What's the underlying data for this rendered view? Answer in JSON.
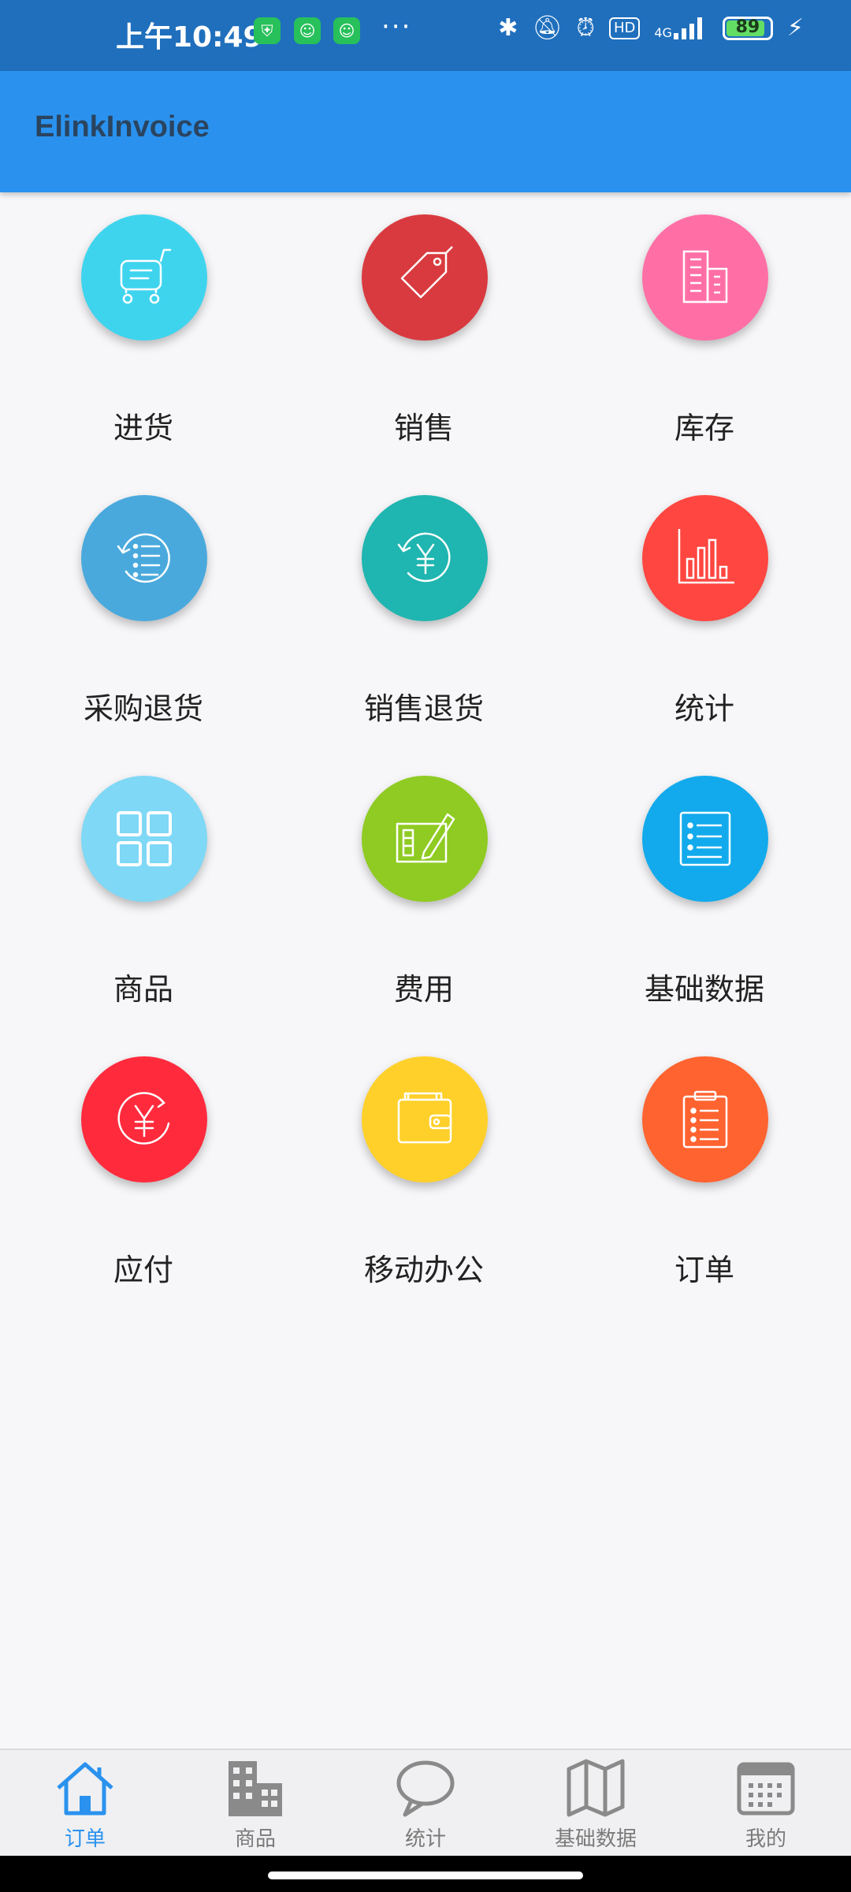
{
  "status_bar": {
    "time": "上午10:49",
    "dots": "···",
    "hd": "HD",
    "network": "4G",
    "battery": "89",
    "battery_level": 0.89
  },
  "app_bar": {
    "title": "ElinkInvoice"
  },
  "grid": [
    {
      "label": "进货",
      "icon": "cart-icon",
      "color": "#3fd4ee"
    },
    {
      "label": "销售",
      "icon": "tag-icon",
      "color": "#d93a3f"
    },
    {
      "label": "库存",
      "icon": "building-icon",
      "color": "#ff6fa6"
    },
    {
      "label": "采购退货",
      "icon": "return-list-icon",
      "color": "#49a9dd"
    },
    {
      "label": "销售退货",
      "icon": "return-yen-icon",
      "color": "#1fb5b0"
    },
    {
      "label": "统计",
      "icon": "bar-chart-icon",
      "color": "#ff4640"
    },
    {
      "label": "商品",
      "icon": "grid-icon",
      "color": "#7fd8f5"
    },
    {
      "label": "费用",
      "icon": "edit-tablet-icon",
      "color": "#8fcb22"
    },
    {
      "label": "基础数据",
      "icon": "list-icon",
      "color": "#12aaec"
    },
    {
      "label": "应付",
      "icon": "yen-circle-icon",
      "color": "#ff2b3d"
    },
    {
      "label": "移动办公",
      "icon": "wallet-icon",
      "color": "#ffd02a"
    },
    {
      "label": "订单",
      "icon": "clipboard-icon",
      "color": "#ff6330"
    }
  ],
  "bottom_nav": [
    {
      "label": "订单",
      "icon": "home-icon",
      "active": true
    },
    {
      "label": "商品",
      "icon": "buildings-icon",
      "active": false
    },
    {
      "label": "统计",
      "icon": "chat-bubble-icon",
      "active": false
    },
    {
      "label": "基础数据",
      "icon": "map-icon",
      "active": false
    },
    {
      "label": "我的",
      "icon": "calendar-icon",
      "active": false
    }
  ],
  "colors": {
    "primary": "#2a92ee",
    "status_bar": "#1f6fbd"
  }
}
